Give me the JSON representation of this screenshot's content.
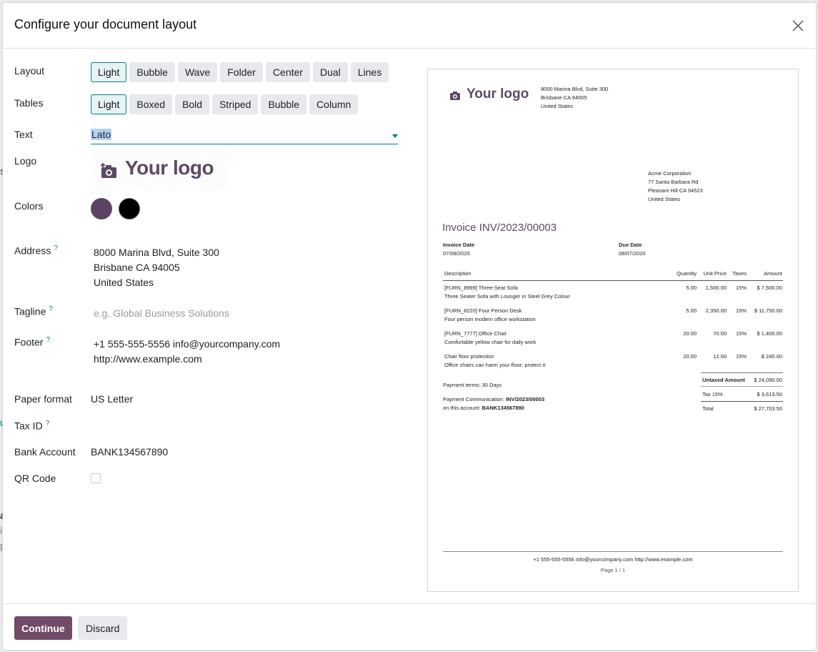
{
  "dialog": {
    "title": "Configure your document layout",
    "labels": {
      "layout": "Layout",
      "tables": "Tables",
      "text": "Text",
      "logo": "Logo",
      "colors": "Colors",
      "address": "Address",
      "tagline": "Tagline",
      "footer": "Footer",
      "paper_format": "Paper format",
      "tax_id": "Tax ID",
      "bank_account": "Bank Account",
      "qr_code": "QR Code",
      "help": "?"
    },
    "layout_options": [
      "Light",
      "Bubble",
      "Wave",
      "Folder",
      "Center",
      "Dual",
      "Lines"
    ],
    "table_options": [
      "Light",
      "Boxed",
      "Bold",
      "Striped",
      "Bubble",
      "Column"
    ],
    "font": "Lato",
    "logo_text": "Your logo",
    "colors": {
      "primary": "#5b4363",
      "secondary": "#000000"
    },
    "address_lines": [
      "8000 Marina Blvd, Suite 300",
      "Brisbane CA 94005",
      "United States"
    ],
    "tagline_placeholder": "e.g. Global Business Solutions",
    "footer_lines": [
      "+1 555-555-5556 info@yourcompany.com",
      "http://www.example.com"
    ],
    "paper_format": "US Letter",
    "bank_account": "BANK134567890",
    "continue_label": "Continue",
    "discard_label": "Discard"
  },
  "preview": {
    "logo_text": "Your logo",
    "company_address": [
      "8000 Marina Blvd, Suite 300",
      "Brisbane CA 94005",
      "United States"
    ],
    "customer_address": [
      "Acme Corporation",
      "77 Santa Barbara Rd",
      "Pleasant Hill CA 94523",
      "United States"
    ],
    "invoice_title": "Invoice INV/2023/00003",
    "invoice_date_label": "Invoice Date",
    "invoice_date": "07/08/2020",
    "due_date_label": "Due Date",
    "due_date": "08/07/2020",
    "columns": [
      "Description",
      "Quantity",
      "Unit Price",
      "Taxes",
      "Amount"
    ],
    "lines": [
      {
        "name": "[FURN_8999] Three-Seat Sofa",
        "desc": "Three Seater Sofa with Lounger in Steel Grey Colour",
        "qty": "5.00",
        "price": "1,500.00",
        "tax": "15%",
        "amount": "$ 7,500.00"
      },
      {
        "name": "[FURN_8220] Four Person Desk",
        "desc": "Four person modern office workstation",
        "qty": "5.00",
        "price": "2,350.00",
        "tax": "15%",
        "amount": "$ 11,750.00"
      },
      {
        "name": "[FURN_7777] Office Chair",
        "desc": "Comfortable yellow chair for daily work",
        "qty": "20.00",
        "price": "70.00",
        "tax": "15%",
        "amount": "$ 1,400.00"
      },
      {
        "name": "Chair floor protection",
        "desc": "Office chairs can harm your floor: protect it",
        "qty": "20.00",
        "price": "12.00",
        "tax": "15%",
        "amount": "$ 240.00"
      }
    ],
    "untaxed_label": "Untaxed Amount",
    "untaxed": "$ 24,090.00",
    "tax_label": "Tax 15%",
    "tax": "$ 3,613.50",
    "total_label": "Total",
    "total": "$ 27,703.50",
    "payment_terms": "Payment terms: 30 Days",
    "payment_comm_label": "Payment Communication:",
    "payment_comm": "INV/2023/00003",
    "account_label": "on this account:",
    "account": "BANK134567890",
    "footer": "+1 555-555-5556 info@yourcompany.com http://www.example.com",
    "page": "Page 1 / 1"
  },
  "background": {
    "fragments": [
      "s",
      "u",
      "a",
      "i",
      "p"
    ]
  }
}
